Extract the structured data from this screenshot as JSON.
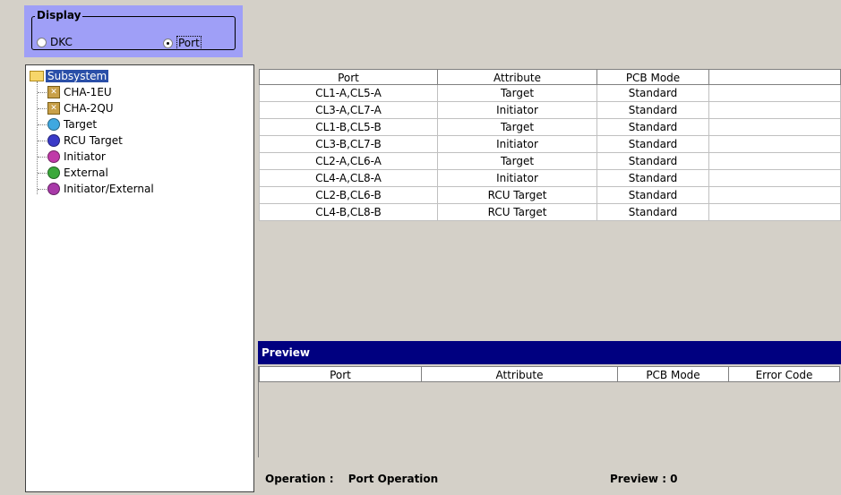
{
  "display": {
    "legend": "Display",
    "options": [
      {
        "label": "DKC",
        "checked": false
      },
      {
        "label": "Port",
        "checked": true
      }
    ]
  },
  "tree": {
    "root": "Subsystem",
    "items": [
      {
        "label": "CHA-1EU",
        "icon": "cha-chip-icon"
      },
      {
        "label": "CHA-2QU",
        "icon": "cha-chip-icon"
      },
      {
        "label": "Target",
        "icon": "target-port-icon",
        "color": "#3fa8e0"
      },
      {
        "label": "RCU Target",
        "icon": "rcu-target-port-icon",
        "color": "#3a3ac8"
      },
      {
        "label": "Initiator",
        "icon": "initiator-port-icon",
        "color": "#c03aa8"
      },
      {
        "label": "External",
        "icon": "external-port-icon",
        "color": "#3aa83a"
      },
      {
        "label": "Initiator/External",
        "icon": "initiator-external-port-icon",
        "color": "#a83aa8"
      }
    ]
  },
  "port_table": {
    "columns": [
      "Port",
      "Attribute",
      "PCB Mode",
      ""
    ],
    "rows": [
      [
        "CL1-A,CL5-A",
        "Target",
        "Standard",
        ""
      ],
      [
        "CL3-A,CL7-A",
        "Initiator",
        "Standard",
        ""
      ],
      [
        "CL1-B,CL5-B",
        "Target",
        "Standard",
        ""
      ],
      [
        "CL3-B,CL7-B",
        "Initiator",
        "Standard",
        ""
      ],
      [
        "CL2-A,CL6-A",
        "Target",
        "Standard",
        ""
      ],
      [
        "CL4-A,CL8-A",
        "Initiator",
        "Standard",
        ""
      ],
      [
        "CL2-B,CL6-B",
        "RCU Target",
        "Standard",
        ""
      ],
      [
        "CL4-B,CL8-B",
        "RCU Target",
        "Standard",
        ""
      ]
    ]
  },
  "preview": {
    "title": "Preview",
    "columns": [
      "Port",
      "Attribute",
      "PCB Mode",
      "Error Code"
    ],
    "operation_label": "Operation :",
    "operation_value": "Port Operation",
    "count_label": "Preview : 0"
  },
  "colors": {
    "display_bg": "#9f9ff7",
    "preview_bar": "#000080",
    "selection": "#2a4fa8"
  }
}
